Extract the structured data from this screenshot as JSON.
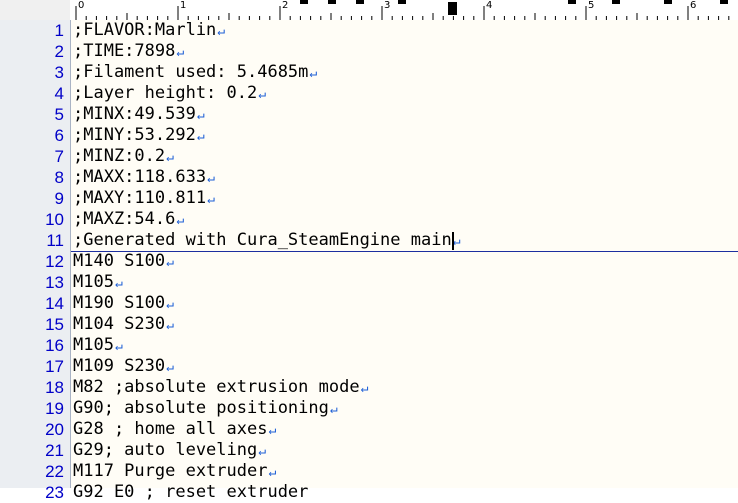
{
  "ruler": {
    "labels": [
      "0",
      "1",
      "2",
      "3",
      "4",
      "5",
      "6"
    ]
  },
  "editor": {
    "eol_marker": "↵",
    "current_line": 11,
    "lines": [
      {
        "num": "1",
        "text": ";FLAVOR:Marlin"
      },
      {
        "num": "2",
        "text": ";TIME:7898"
      },
      {
        "num": "3",
        "text": ";Filament used: 5.4685m"
      },
      {
        "num": "4",
        "text": ";Layer height: 0.2"
      },
      {
        "num": "5",
        "text": ";MINX:49.539"
      },
      {
        "num": "6",
        "text": ";MINY:53.292"
      },
      {
        "num": "7",
        "text": ";MINZ:0.2"
      },
      {
        "num": "8",
        "text": ";MAXX:118.633"
      },
      {
        "num": "9",
        "text": ";MAXY:110.811"
      },
      {
        "num": "10",
        "text": ";MAXZ:54.6"
      },
      {
        "num": "11",
        "text": ";Generated with Cura_SteamEngine main"
      },
      {
        "num": "12",
        "text": "M140 S100"
      },
      {
        "num": "13",
        "text": "M105"
      },
      {
        "num": "14",
        "text": "M190 S100"
      },
      {
        "num": "15",
        "text": "M104 S230"
      },
      {
        "num": "16",
        "text": "M105"
      },
      {
        "num": "17",
        "text": "M109 S230"
      },
      {
        "num": "18",
        "text": "M82 ;absolute extrusion mode"
      },
      {
        "num": "19",
        "text": "G90; absolute positioning"
      },
      {
        "num": "20",
        "text": "G28 ; home all axes"
      },
      {
        "num": "21",
        "text": "G29; auto leveling"
      },
      {
        "num": "22",
        "text": "M117 Purge extruder"
      },
      {
        "num": "23",
        "text": "G92 E0 ; reset extruder"
      }
    ]
  }
}
